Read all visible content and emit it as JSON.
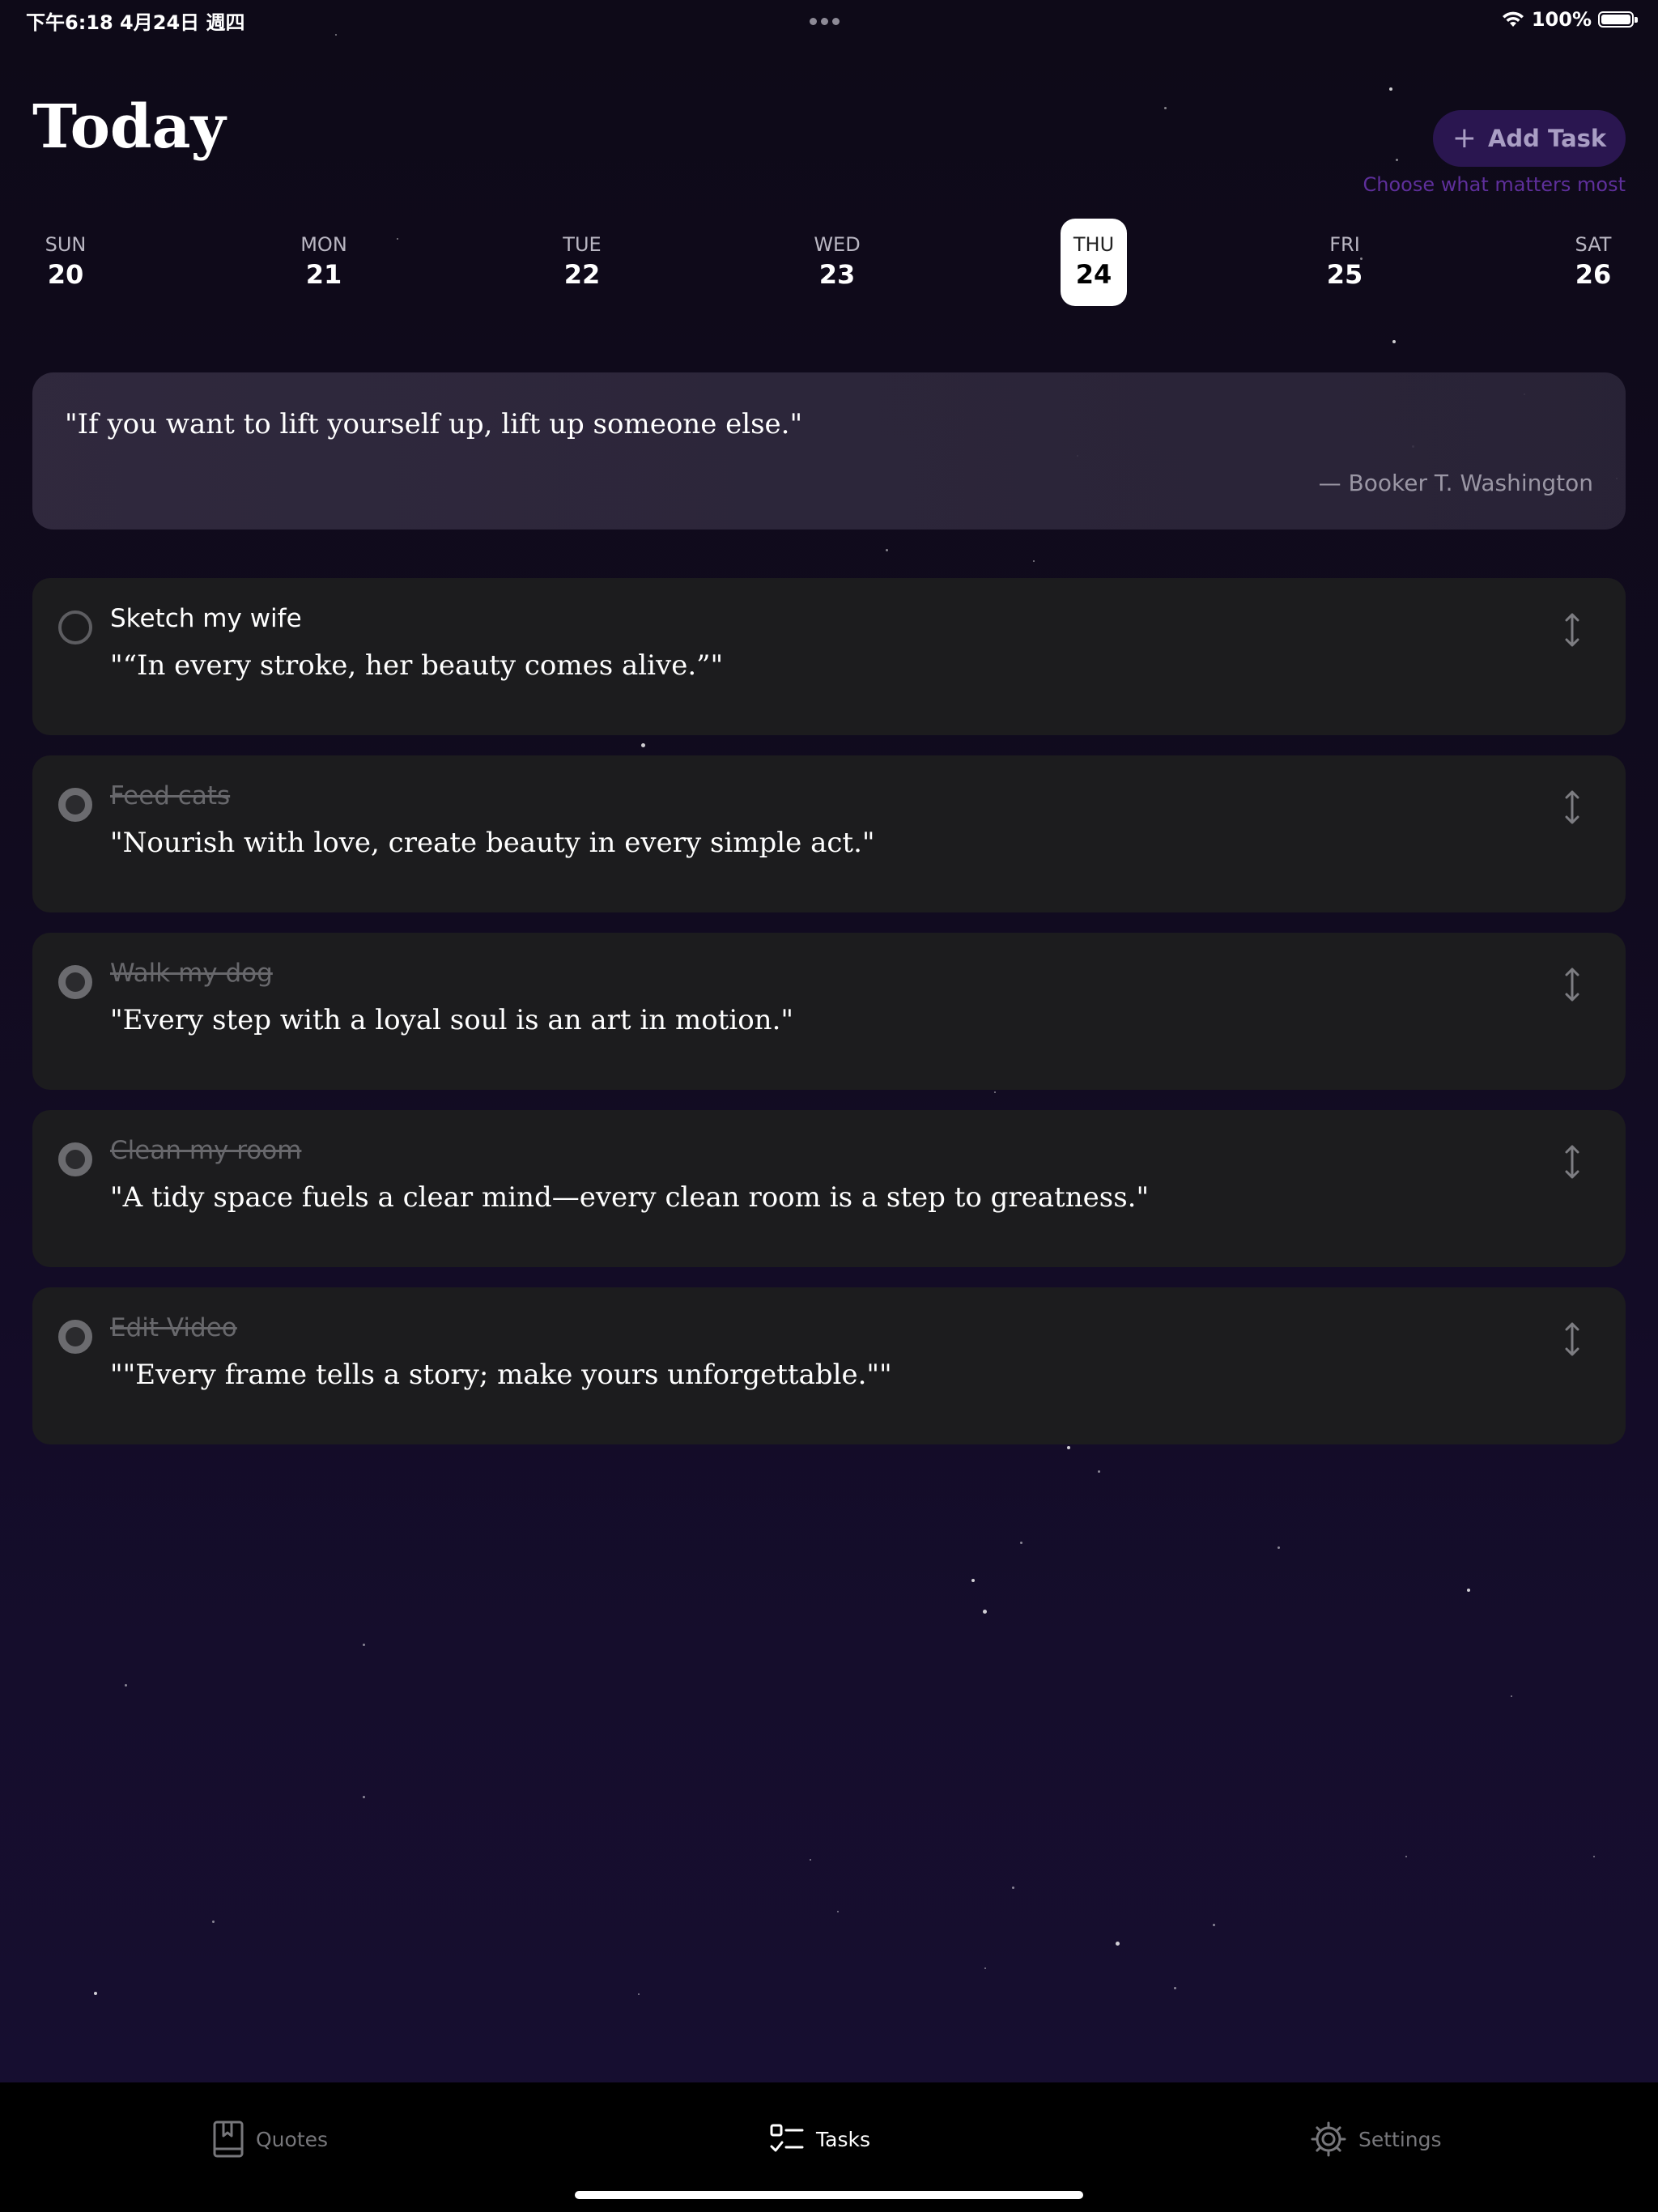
{
  "status_bar": {
    "time": "下午6:18   4月24日 週四",
    "battery": "100%"
  },
  "header": {
    "title": "Today",
    "add_task_label": "Add Task",
    "subtitle": "Choose what matters most"
  },
  "week": [
    {
      "dow": "SUN",
      "num": "20",
      "selected": false
    },
    {
      "dow": "MON",
      "num": "21",
      "selected": false
    },
    {
      "dow": "TUE",
      "num": "22",
      "selected": false
    },
    {
      "dow": "WED",
      "num": "23",
      "selected": false
    },
    {
      "dow": "THU",
      "num": "24",
      "selected": true
    },
    {
      "dow": "FRI",
      "num": "25",
      "selected": false
    },
    {
      "dow": "SAT",
      "num": "26",
      "selected": false
    }
  ],
  "daily_quote": {
    "text": "\"If you want to lift yourself up, lift up someone else.\"",
    "author": "— Booker T. Washington"
  },
  "tasks": [
    {
      "title": "Sketch my wife",
      "quote": "\"“In every stroke, her beauty comes alive.”\"",
      "done": false
    },
    {
      "title": "Feed cats",
      "quote": "\"Nourish with love, create beauty in every simple act.\"",
      "done": true
    },
    {
      "title": "Walk my dog",
      "quote": "\"Every step with a loyal soul is an art in motion.\"",
      "done": true
    },
    {
      "title": "Clean my room",
      "quote": "\"A tidy space fuels a clear mind—every clean room is a step to greatness.\"",
      "done": true
    },
    {
      "title": "Edit Video",
      "quote": "\"\"Every frame tells a story; make yours unforgettable.\"\"",
      "done": true
    }
  ],
  "tab_bar": {
    "quotes": "Quotes",
    "tasks": "Tasks",
    "settings": "Settings",
    "active": "tasks"
  },
  "colors": {
    "accent": "#2a1650",
    "accent_text": "#5e2f9b",
    "card": "#1c1c1e"
  }
}
